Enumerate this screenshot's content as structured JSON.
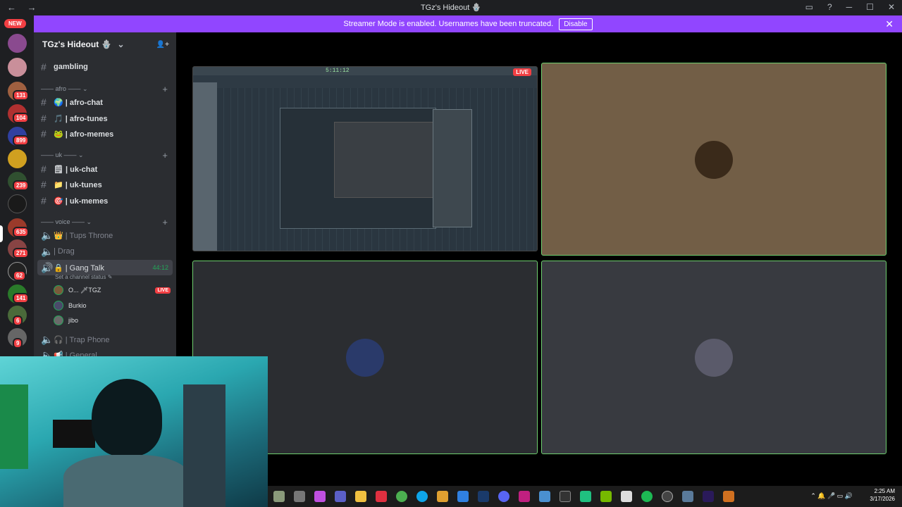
{
  "window": {
    "title": "TGz's Hideout 🪬",
    "nav": "← →",
    "controls": [
      "▭",
      "?",
      "─",
      "☐",
      "✕"
    ]
  },
  "banner": {
    "text": "Streamer Mode is enabled. Usernames have been truncated.",
    "button": "Disable",
    "close": "✕"
  },
  "guilds": {
    "new_label": "NEW",
    "badges": [
      "131",
      "104",
      "899",
      "239",
      "635",
      "271",
      "62",
      "141",
      "6",
      "9"
    ]
  },
  "server": {
    "name": "TGz's Hideout 🪬",
    "chevron": "⌄",
    "invite_icon": "👤+"
  },
  "channels": {
    "gambling": "gambling",
    "cat_afro": "—— afro ——  ⌄",
    "afro_chat": "🌍 | afro-chat",
    "afro_tunes": "🎵 | afro-tunes",
    "afro_memes": "🐸 | afro-memes",
    "cat_uk": "—— uk ——  ⌄",
    "uk_chat": "🗒 | uk-chat",
    "uk_tunes": "📁 | uk-tunes",
    "uk_memes": "🎯 | uk-memes",
    "cat_voice": "—— voice ——  ⌄",
    "tups": "👑 | Tups Throne",
    "drag": "| Drag",
    "gang": "🔒 | Gang Talk",
    "gang_time": "44:12",
    "status": "Set a channel status ✎",
    "trap": "🎧 | Trap Phone",
    "general": "📢 | General"
  },
  "members": [
    {
      "name": "O... 🗡TGZ",
      "live": "LIVE"
    },
    {
      "name": "Burkio"
    },
    {
      "name": "jibo"
    }
  ],
  "stream": {
    "live": "LIVE",
    "time": "5:11:12"
  },
  "tray": {
    "time": "2:25 AM",
    "date": "3/17/2026",
    "icons": "⌃  🔔  🎤  ▭  🔊"
  }
}
